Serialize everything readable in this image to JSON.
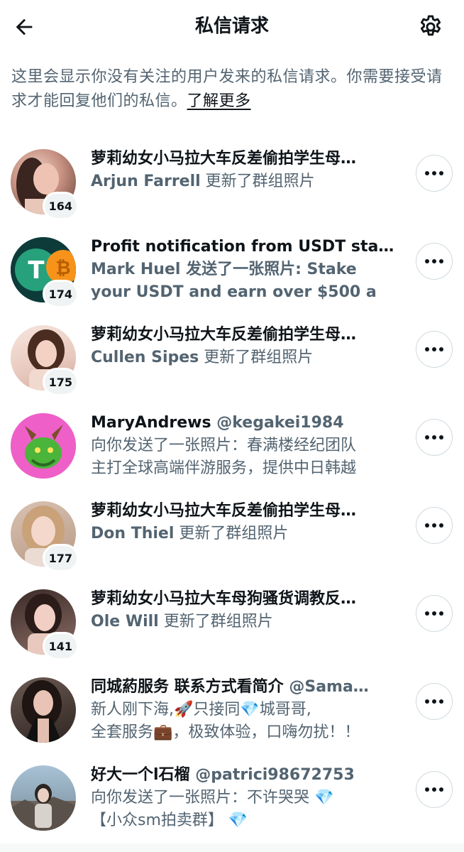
{
  "header": {
    "title": "私信请求",
    "back_icon": "arrow-left-icon",
    "settings_icon": "gear-icon"
  },
  "intro": {
    "text": "这里会显示你没有关注的用户发来的私信请求。你需要接受请求才能回复他们的私信。",
    "link": "了解更多"
  },
  "requests": [
    {
      "title": "萝莉幼女小马拉大车反差偷拍学生母…",
      "handle": "",
      "sender": "Arjun Farrell",
      "preview": " 更新了群组照片",
      "preview2": "",
      "badge": "164"
    },
    {
      "title": "Profit notification from USDT sta…",
      "handle": "",
      "sender": "Mark Huel",
      "preview": " 发送了一张照片: Stake",
      "preview2": "your USDT and earn over $500 a",
      "badge": "174"
    },
    {
      "title": "萝莉幼女小马拉大车反差偷拍学生母…",
      "handle": "",
      "sender": "Cullen Sipes",
      "preview": " 更新了群组照片",
      "preview2": "",
      "badge": "175"
    },
    {
      "title": "MaryAndrews",
      "handle": "@kegakei1984",
      "sender": "",
      "preview": "向你发送了一张照片：春满楼经纪团队",
      "preview2": "主打全球高端伴游服务，提供中日韩越",
      "badge": ""
    },
    {
      "title": "萝莉幼女小马拉大车反差偷拍学生母…",
      "handle": "",
      "sender": "Don Thiel",
      "preview": " 更新了群组照片",
      "preview2": "",
      "badge": "177"
    },
    {
      "title": "萝莉幼女小马拉大车母狗骚货调教反…",
      "handle": "",
      "sender": "Ole Will",
      "preview": " 更新了群组照片",
      "preview2": "",
      "badge": "141"
    },
    {
      "title": "同城葯服务 联系方式看简介",
      "handle": "@Sama…",
      "sender": "",
      "preview": "新人刚下海,🚀只接同💎城哥哥,",
      "preview2": "全套服务💼，极致体验，口嗨勿扰！！",
      "badge": ""
    },
    {
      "title": "好大一个l石榴",
      "handle": "@patrici98672753",
      "sender": "",
      "preview": "向你发送了一张照片：不许哭哭 💎",
      "preview2": "【小众sm拍卖群】 💎",
      "badge": ""
    }
  ],
  "colors": {
    "primary_text": "#0f1419",
    "secondary_text": "#536471",
    "border": "#cfd9de",
    "badge_bg": "#eff3f4"
  },
  "icons": {
    "more": "more-dots-icon"
  }
}
